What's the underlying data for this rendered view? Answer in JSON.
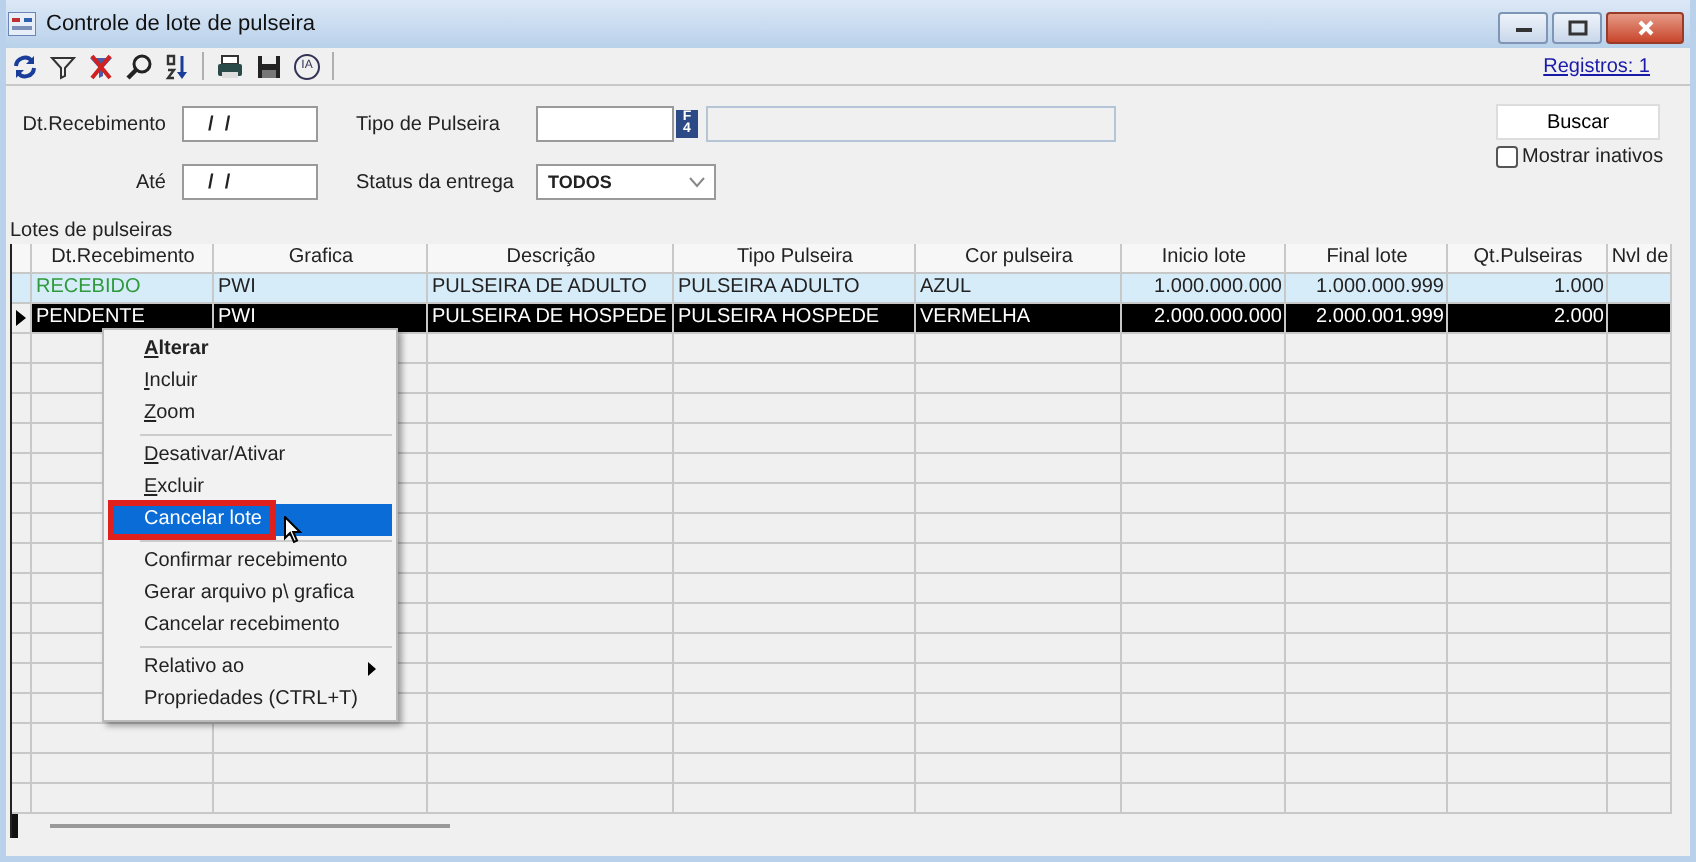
{
  "window": {
    "title": "Controle de lote de pulseira"
  },
  "toolbar": [
    {
      "kind": "refresh"
    },
    {
      "kind": "filter"
    },
    {
      "kind": "clear-filter"
    },
    {
      "kind": "zoom"
    },
    {
      "kind": "sort"
    },
    {
      "kind": "separator"
    },
    {
      "kind": "print"
    },
    {
      "kind": "save"
    },
    {
      "kind": "badge",
      "label": "IA"
    },
    {
      "kind": "separator"
    }
  ],
  "records_link": "Registros: 1",
  "filters": {
    "date_label": "Dt.Recebimento",
    "date_value": "/  /",
    "until_label": "Até",
    "until_value": "/  /",
    "type_label": "Tipo de Pulseira",
    "lookup_key": "F4",
    "status_label": "Status da entrega",
    "status_value": "TODOS",
    "search_button": "Buscar",
    "show_inactive": {
      "label": "Mostrar inativos",
      "checked": false
    }
  },
  "grid": {
    "title": "Lotes de pulseiras",
    "columns": [
      {
        "label": "Dt.Recebimento"
      },
      {
        "label": "Grafica"
      },
      {
        "label": "Descrição"
      },
      {
        "label": "Tipo Pulseira"
      },
      {
        "label": "Cor pulseira"
      },
      {
        "label": "Inicio lote"
      },
      {
        "label": "Final lote"
      },
      {
        "label": "Qt.Pulseiras"
      },
      {
        "label": "Nvl de"
      }
    ],
    "rows": [
      {
        "selected": false,
        "color": "#2f9a3a",
        "cells": [
          "RECEBIDO",
          "PWI",
          "PULSEIRA DE ADULTO",
          "PULSEIRA ADULTO",
          "AZUL",
          "1.000.000.000",
          "1.000.000.999",
          "1.000"
        ]
      },
      {
        "selected": true,
        "color": "#ffffff",
        "cells": [
          "PENDENTE",
          "PWI",
          "PULSEIRA DE HOSPEDE",
          "PULSEIRA HOSPEDE",
          "VERMELHA",
          "2.000.000.000",
          "2.000.001.999",
          "2.000"
        ]
      }
    ]
  },
  "context_menu": {
    "groups": [
      [
        {
          "label": "Alterar",
          "default": true,
          "accelerator": true,
          "selected": false
        },
        {
          "label": "Incluir",
          "accelerator": true,
          "selected": false
        },
        {
          "label": "Zoom",
          "accelerator": true,
          "selected": false
        }
      ],
      [
        {
          "label": "Desativar/Ativar",
          "accelerator": true,
          "selected": false
        },
        {
          "label": "Excluir",
          "accelerator": true,
          "selected": false
        },
        {
          "label": "Cancelar lote",
          "selected": true
        }
      ],
      [
        {
          "label": "Confirmar recebimento",
          "selected": false
        },
        {
          "label": "Gerar arquivo p\\ grafica",
          "selected": false
        },
        {
          "label": "Cancelar recebimento",
          "selected": false
        }
      ],
      [
        {
          "label": "Relativo ao",
          "submenu": true,
          "selected": false
        },
        {
          "label": "Propriedades (CTRL+T)",
          "selected": false
        }
      ]
    ]
  }
}
